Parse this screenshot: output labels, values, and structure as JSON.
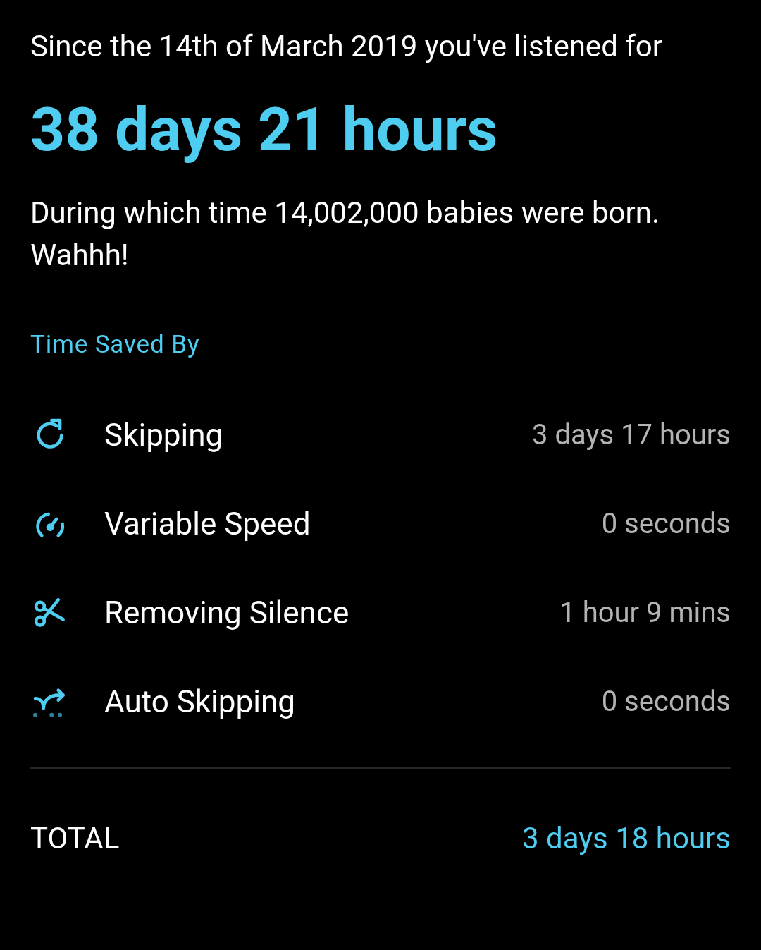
{
  "intro": "Since the 14th of March 2019 you've listened for",
  "total_listened": "38 days 21 hours",
  "fun_fact": "During which time 14,002,000 babies were born. Wahhh!",
  "section_title": "Time Saved By",
  "rows": [
    {
      "kind": "skip",
      "label": "Skipping",
      "value": "3 days 17 hours"
    },
    {
      "kind": "speed",
      "label": "Variable Speed",
      "value": "0 seconds"
    },
    {
      "kind": "silence",
      "label": "Removing Silence",
      "value": "1 hour 9 mins"
    },
    {
      "kind": "autoskip",
      "label": "Auto Skipping",
      "value": "0 seconds"
    }
  ],
  "total": {
    "label": "TOTAL",
    "value": "3 days 18 hours"
  }
}
